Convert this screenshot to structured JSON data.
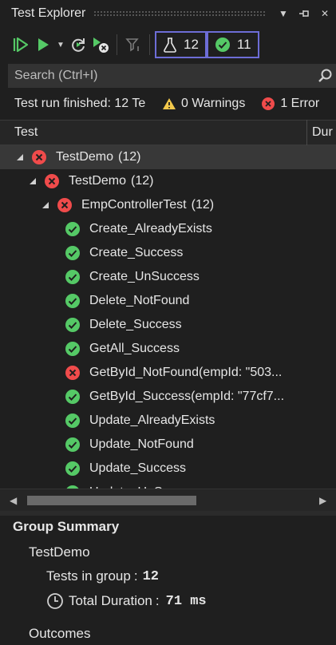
{
  "window": {
    "title": "Test Explorer"
  },
  "toolbar": {
    "total_count": "12",
    "passed_count": "11"
  },
  "search": {
    "placeholder": "Search (Ctrl+I)"
  },
  "status": {
    "run_text": "Test run finished: 12 Te",
    "warnings": "0 Warnings",
    "errors": "1 Error"
  },
  "columns": {
    "test": "Test",
    "duration": "Dur"
  },
  "tree": [
    {
      "label": "TestDemo",
      "count": "(12)",
      "state": "failed"
    },
    {
      "label": "TestDemo",
      "count": "(12)",
      "state": "failed"
    },
    {
      "label": "EmpControllerTest",
      "count": "(12)",
      "state": "failed"
    },
    {
      "label": "Create_AlreadyExists",
      "state": "passed"
    },
    {
      "label": "Create_Success",
      "state": "passed"
    },
    {
      "label": "Create_UnSuccess",
      "state": "passed"
    },
    {
      "label": "Delete_NotFound",
      "state": "passed"
    },
    {
      "label": "Delete_Success",
      "state": "passed"
    },
    {
      "label": "GetAll_Success",
      "state": "passed"
    },
    {
      "label": "GetById_NotFound(empId: \"503...",
      "state": "failed"
    },
    {
      "label": "GetById_Success(empId: \"77cf7...",
      "state": "passed"
    },
    {
      "label": "Update_AlreadyExists",
      "state": "passed"
    },
    {
      "label": "Update_NotFound",
      "state": "passed"
    },
    {
      "label": "Update_Success",
      "state": "passed"
    },
    {
      "label": "Update_UnSuccess",
      "state": "passed"
    }
  ],
  "summary": {
    "title": "Group Summary",
    "group": "TestDemo",
    "tests_label": "Tests in group",
    "tests_value": "12",
    "duration_label": "Total Duration",
    "duration_value": "71 ms",
    "outcomes": "Outcomes"
  },
  "colors": {
    "passed": "#55c966",
    "failed": "#f04b4b",
    "accent": "#6d6dd6",
    "warning": "#f2c84b"
  }
}
